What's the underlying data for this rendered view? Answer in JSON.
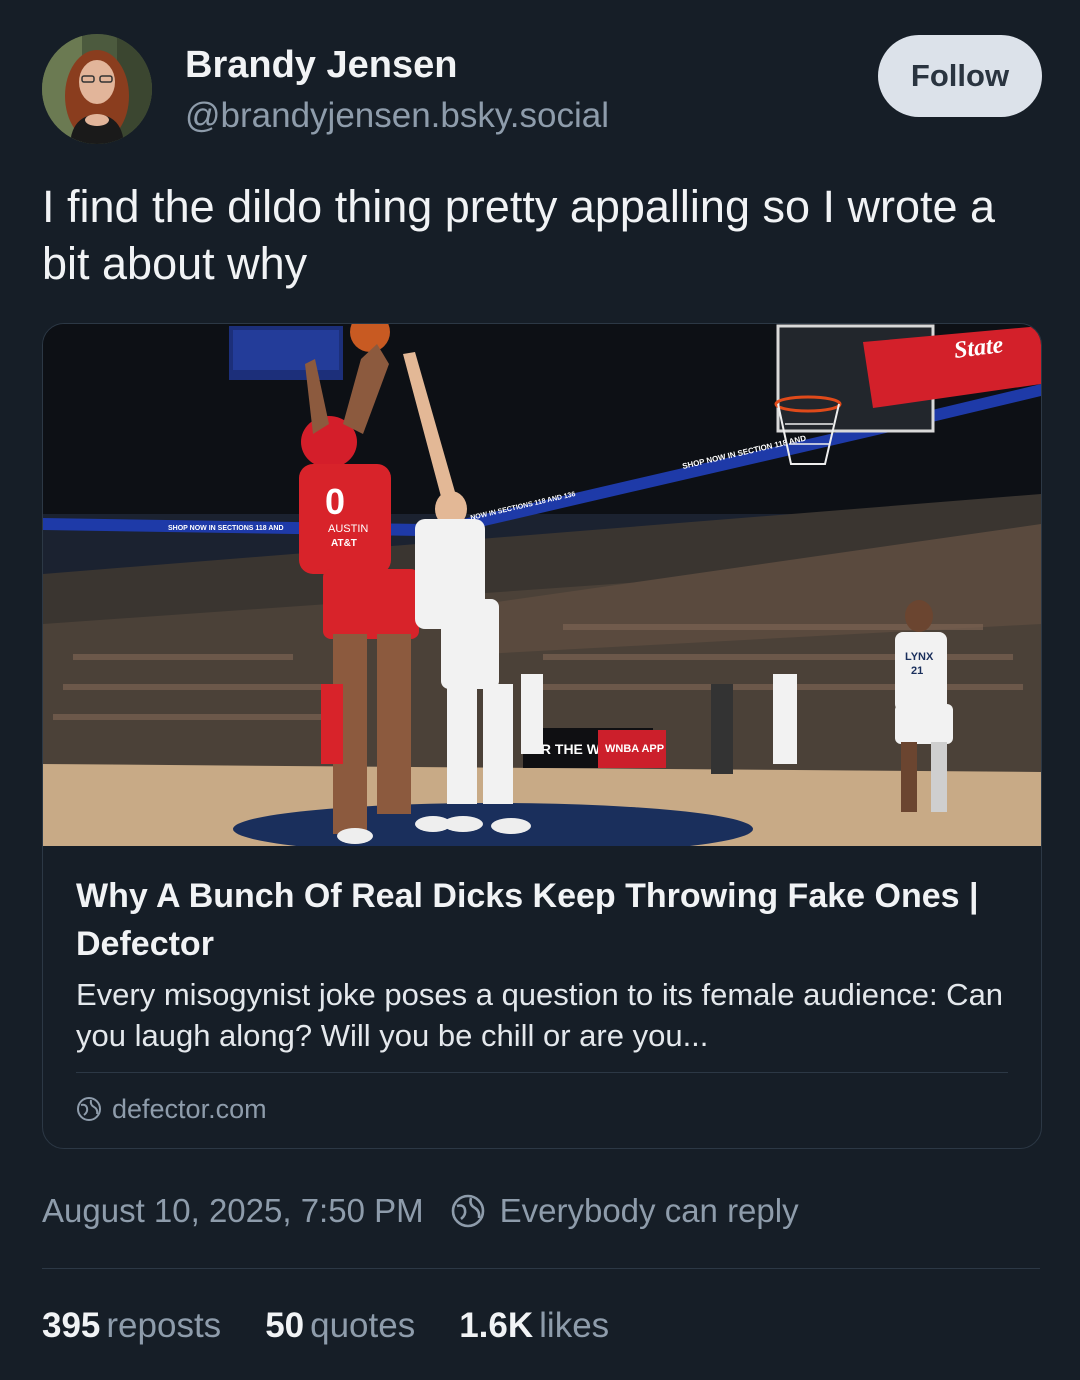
{
  "author": {
    "display_name": "Brandy Jensen",
    "handle": "@brandyjensen.bsky.social",
    "follow_label": "Follow"
  },
  "post": {
    "text": "I find the dildo thing pretty appalling so I wrote a bit about why",
    "timestamp": "August 10, 2025, 7:50 PM",
    "reply_setting": "Everybody can reply"
  },
  "link_card": {
    "title": "Why A Bunch Of Real Dicks Keep Throwing Fake Ones | Defector",
    "description": "Every misogynist joke poses a question to its female audience: Can you laugh along? Will you be chill or are you...",
    "domain": "defector.com",
    "image_text": {
      "jersey_number": "0",
      "jersey_name": "AUSTIN",
      "jersey_sponsor": "AT&T",
      "ribbon_left": "SHOP NOW IN SECTIONS 118 AND",
      "ribbon_mid": "NOW IN SECTIONS 118 AND 136",
      "ribbon_right": "SHOP NOW IN SECTION 118 AND",
      "sign_state": "State",
      "board_left": "OR THE W",
      "board_app": "WNBA APP",
      "lynx_jersey": "LYNX",
      "lynx_number": "21"
    }
  },
  "stats": {
    "reposts_count": "395",
    "reposts_label": "reposts",
    "quotes_count": "50",
    "quotes_label": "quotes",
    "likes_count": "1.6K",
    "likes_label": "likes"
  },
  "colors": {
    "background": "#161e27",
    "muted_text": "#8e9cab",
    "follow_button": "#dce2ea",
    "mystics_red": "#d8232a",
    "court_wood": "#c8aa86"
  }
}
